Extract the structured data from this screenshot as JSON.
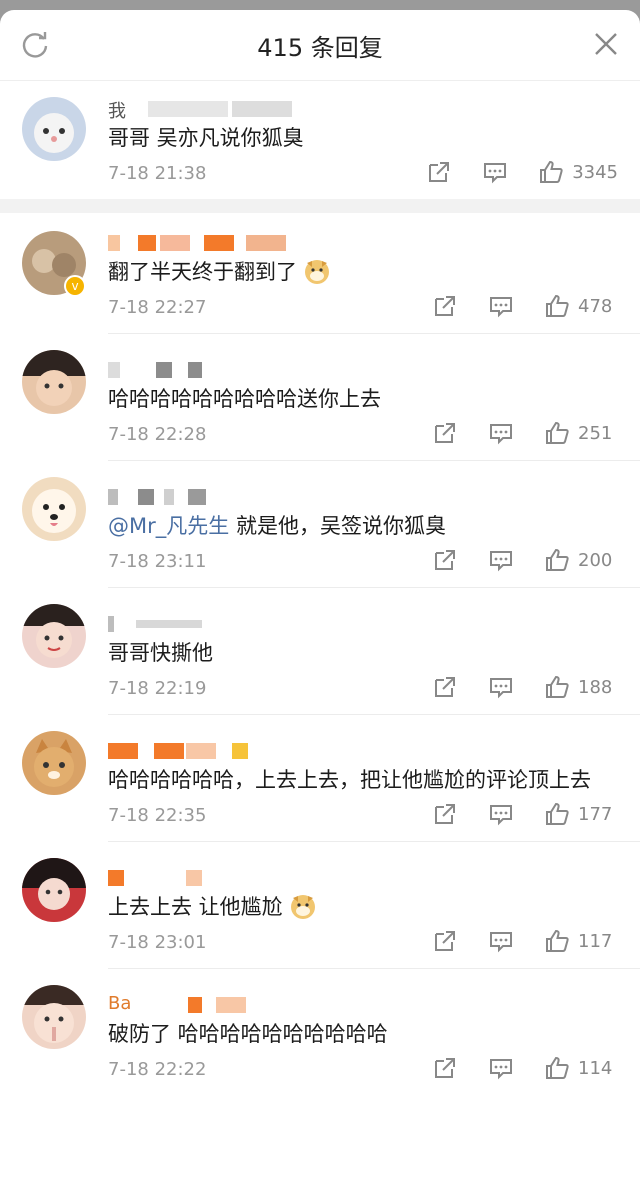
{
  "header": {
    "title": "415 条回复"
  },
  "comments": [
    {
      "name": "我",
      "text": "哥哥 吴亦凡说你狐臭",
      "time": "7-18 21:38",
      "likes": "3345",
      "verified": false,
      "avatar_color": "#c9d6e8"
    },
    {
      "name": "",
      "text": "翻了半天终于翻到了",
      "time": "7-18 22:27",
      "likes": "478",
      "verified": true,
      "avatar_color": "#b89c7c",
      "emoji": "doge"
    },
    {
      "name": "",
      "text": "哈哈哈哈哈哈哈哈哈送你上去",
      "time": "7-18 22:28",
      "likes": "251",
      "verified": false,
      "avatar_color": "#e8c6a9"
    },
    {
      "name": "",
      "mention": "@Mr_凡先生",
      "text": " 就是他，吴签说你狐臭",
      "time": "7-18 23:11",
      "likes": "200",
      "verified": false,
      "avatar_color": "#f1dcc0"
    },
    {
      "name": "",
      "text": "哥哥快撕他",
      "time": "7-18 22:19",
      "likes": "188",
      "verified": false,
      "avatar_color": "#efd3cd"
    },
    {
      "name": "",
      "text": "哈哈哈哈哈哈，上去上去，把让他尴尬的评论顶上去",
      "time": "7-18 22:35",
      "likes": "177",
      "verified": false,
      "avatar_color": "#d9a266"
    },
    {
      "name": "",
      "text": "上去上去 让他尴尬",
      "time": "7-18 23:01",
      "likes": "117",
      "verified": false,
      "avatar_color": "#c9373b",
      "emoji": "doge"
    },
    {
      "name": "Ba",
      "text": "破防了 哈哈哈哈哈哈哈哈哈哈",
      "time": "7-18 22:22",
      "likes": "114",
      "verified": false,
      "avatar_color": "#f0d4c6"
    }
  ],
  "colors": {
    "mention": "#4a6fa3",
    "name_mask_orange": "#f37a2a",
    "name_mask_gray": "#8c8c8c"
  }
}
